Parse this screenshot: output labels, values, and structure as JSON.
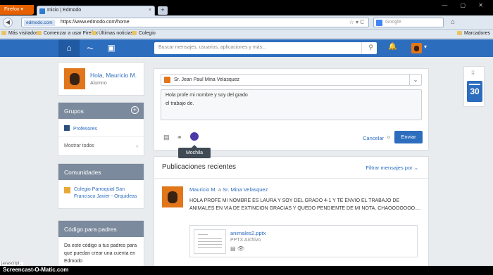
{
  "browser": {
    "menu_label": "Firefox ▾",
    "tab_title": "Inicio | Edmodo",
    "tab_close": "×",
    "new_tab": "+",
    "url_site": "edmodo.com",
    "url": "https://www.edmodo.com/home",
    "url_icons": "☆ ▾ C",
    "search_placeholder": "Google",
    "home_icon": "⌂",
    "window_controls": "— ▢ ✕",
    "bookmarks": [
      "Más visitados",
      "Comenzar a usar Firefox",
      "Últimas noticias",
      "Colegio"
    ],
    "bookmarks_right": "Marcadores"
  },
  "header": {
    "search_placeholder": "Buscar mensajes, usuarios, aplicaciones y más...",
    "nav_icons": [
      "home-icon",
      "activity-icon",
      "backpack-icon"
    ],
    "home_glyph": "⌂",
    "activity_glyph": "⏦",
    "backpack_glyph": "▣",
    "search_glyph": "⚲",
    "bell_glyph": "🔔",
    "caret_glyph": "▾"
  },
  "profile": {
    "greeting": "Hola, Mauricio M.",
    "role": "Alumno"
  },
  "groups": {
    "title": "Grupos",
    "add_glyph": "+",
    "items": [
      "Profesores"
    ],
    "show_all": "Mostrar todos",
    "chevron": "›"
  },
  "communities": {
    "title": "Comunidades",
    "items": [
      "Colegio Parroquial San Francisco Javier - Orquideas"
    ]
  },
  "parent_code": {
    "title": "Código para padres",
    "text": "Da este código a tus padres para que puedan crear una cuenta en Edmodo"
  },
  "composer": {
    "recipient": "Sr. Jean Paul Mina Velasquez",
    "dropdown_glyph": "⌄",
    "message_line1": "Hola profe mi nombre y soy del grado",
    "message_line2": "el trabajo de.",
    "tool_file": "▤",
    "tool_link": "⚭",
    "tooltip": "Mochila",
    "cancel": "Cancelar",
    "or": "o",
    "send": "Enviar"
  },
  "feed": {
    "title": "Publicaciones recientes",
    "filter": "Filtrar mensajes por ⌄",
    "post": {
      "author": "Mauricio M.",
      "connector": "a",
      "recipient": "Sr. Mina Velasquez",
      "body": "HOLA PROFE MI NOMBRE ES LAURA Y SOY DEL GRADO 4-1 Y TE ENVIO EL TRABAJO DE ANIMALES EN VIA DE EXTINCION GRACIAS Y QUEDO PENDIENTE DE MI NOTA. CHAOOOOOOO....",
      "attachment_name": "animales2.pptx",
      "attachment_type": "PPTX Archivo",
      "attachment_icons": "▤ 👁"
    }
  },
  "widgets": {
    "apps_glyph": "⁞⁞",
    "calendar_day": "30"
  },
  "status_text": "javascript:;",
  "watermark": "Screencast-O-Matic.com"
}
